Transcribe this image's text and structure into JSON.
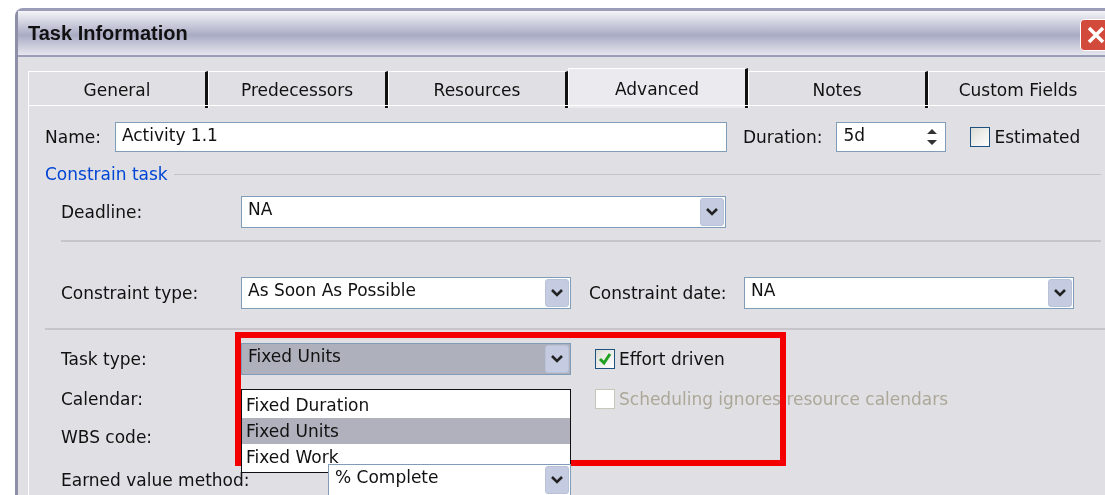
{
  "window": {
    "title": "Task Information"
  },
  "tabs": [
    {
      "label": "General",
      "selected": false
    },
    {
      "label": "Predecessors",
      "selected": false
    },
    {
      "label": "Resources",
      "selected": false
    },
    {
      "label": "Advanced",
      "selected": true
    },
    {
      "label": "Notes",
      "selected": false
    },
    {
      "label": "Custom Fields",
      "selected": false
    }
  ],
  "name": {
    "label": "Name:",
    "value": "Activity 1.1"
  },
  "duration": {
    "label": "Duration:",
    "value": "5d"
  },
  "estimated": {
    "label": "Estimated",
    "checked": false
  },
  "constrain_task": {
    "title": "Constrain task",
    "deadline": {
      "label": "Deadline:",
      "value": "NA"
    },
    "constraint_type": {
      "label": "Constraint type:",
      "value": "As Soon As Possible"
    },
    "constraint_date": {
      "label": "Constraint date:",
      "value": "NA"
    }
  },
  "task_type": {
    "label": "Task type:",
    "value": "Fixed Units",
    "expanded": true,
    "options": [
      {
        "label": "Fixed Duration",
        "selected": false
      },
      {
        "label": "Fixed Units",
        "selected": true
      },
      {
        "label": "Fixed Work",
        "selected": false
      }
    ]
  },
  "effort_driven": {
    "label": "Effort driven",
    "checked": true,
    "disabled": false
  },
  "calendar": {
    "label": "Calendar:"
  },
  "scheduling_ignores": {
    "label": "Scheduling ignores resource calendars",
    "checked": false,
    "disabled": true
  },
  "wbs_code": {
    "label": "WBS code:"
  },
  "earned_value_method": {
    "label": "Earned value method:",
    "value": "% Complete"
  }
}
